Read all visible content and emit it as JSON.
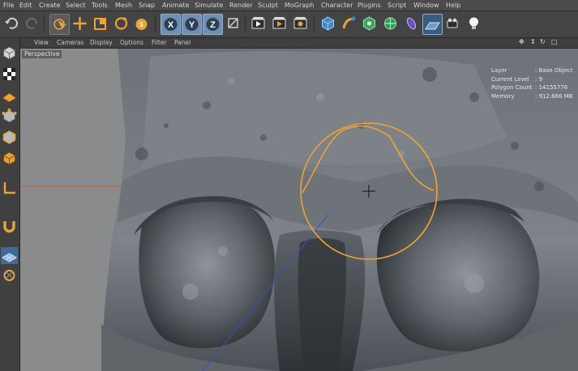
{
  "menu": [
    "File",
    "Edit",
    "Create",
    "Select",
    "Tools",
    "Mesh",
    "Snap",
    "Animate",
    "Simulate",
    "Render",
    "Sculpt",
    "MoGraph",
    "Character",
    "Plugins",
    "Script",
    "Window",
    "Help"
  ],
  "toolbar": {
    "icons": [
      "undo-icon",
      "redo-icon",
      "live-selection-icon",
      "move-icon",
      "scale-icon",
      "rotate-icon",
      "coordinate-system-icon",
      "x-axis-icon",
      "y-axis-icon",
      "z-axis-icon",
      "world-coords-icon",
      "render-view-icon",
      "render-picture-viewer-icon",
      "render-settings-icon",
      "cube-icon",
      "bend-deformer-icon",
      "array-icon",
      "hypernurbs-icon",
      "deformer-icon",
      "floor-icon",
      "camera-icon",
      "light-icon"
    ],
    "axis_labels": [
      "X",
      "Y",
      "Z"
    ]
  },
  "viewport_menu": [
    "View",
    "Cameras",
    "Display",
    "Options",
    "Filter",
    "Panel"
  ],
  "viewport_label": "Perspective",
  "hud": {
    "layer_key": "Layer",
    "layer_value": ": Base Object",
    "level_key": "Current Level",
    "level_value": ": 9",
    "poly_key": "Polygon Count",
    "poly_value": ": 14155776",
    "memory_key": "Memory",
    "memory_value": ": 912.666 MB"
  },
  "colors": {
    "accent_orange": "#e8a23a",
    "viewport_bg": "#8b8c8e",
    "brush_ring": "#f0a32e"
  },
  "left_tools": [
    "model-mode-icon",
    "texture-mode-icon",
    "workplane-icon",
    "points-mode-icon",
    "edges-mode-icon",
    "polygons-mode-icon",
    "axis-mode-icon",
    "magnet-icon",
    "sculpt-grid-icon",
    "sculpt-layers-icon"
  ]
}
